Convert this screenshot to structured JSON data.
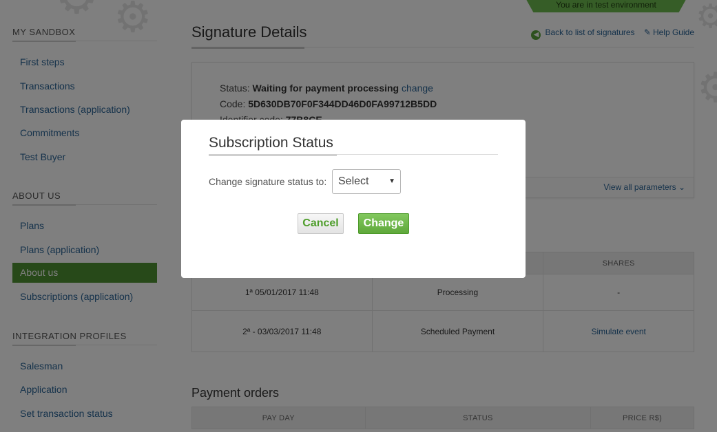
{
  "environment_banner": "You are in test environment",
  "sidebar": {
    "sections": [
      {
        "title": "MY SANDBOX",
        "items": [
          "First steps",
          "Transactions",
          "Transactions (application)",
          "Commitments",
          "Test Buyer"
        ]
      },
      {
        "title": "ABOUT US",
        "items": [
          "Plans",
          "Plans (application)",
          "About us",
          "Subscriptions (application)"
        ]
      },
      {
        "title": "INTEGRATION PROFILES",
        "items": [
          "Salesman",
          "Application",
          "Set transaction status"
        ]
      }
    ],
    "active_item": "About us"
  },
  "main": {
    "title": "Signature Details",
    "back_link": "Back to list of signatures",
    "help_link": "Help Guide",
    "status_label": "Status:",
    "status_value": "Waiting for payment processing",
    "status_change_link": "change",
    "code_label": "Code:",
    "code_value": "5D630DB70F0F344DD46D0FA99712B5DD",
    "identifier_label": "Identifier code:",
    "identifier_value": "77B8CE",
    "view_all_parameters": "View all parameters"
  },
  "shares_table": {
    "headers": [
      "",
      "",
      "SHARES"
    ],
    "rows": [
      [
        "1ª 05/01/2017 11:48",
        "Processing",
        "-"
      ],
      [
        "2ª - 03/03/2017 11:48",
        "Scheduled Payment",
        "Simulate event"
      ]
    ]
  },
  "payment_orders": {
    "title": "Payment orders",
    "headers": [
      "PAY DAY",
      "STATUS",
      "PRICE R$)"
    ]
  },
  "modal": {
    "title": "Subscription Status",
    "label": "Change signature status to:",
    "select_value": "Select",
    "cancel_label": "Cancel",
    "change_label": "Change"
  },
  "colors": {
    "accent_green": "#4f9233",
    "link_blue": "#2a6496",
    "button_green": "#6cb84a"
  }
}
